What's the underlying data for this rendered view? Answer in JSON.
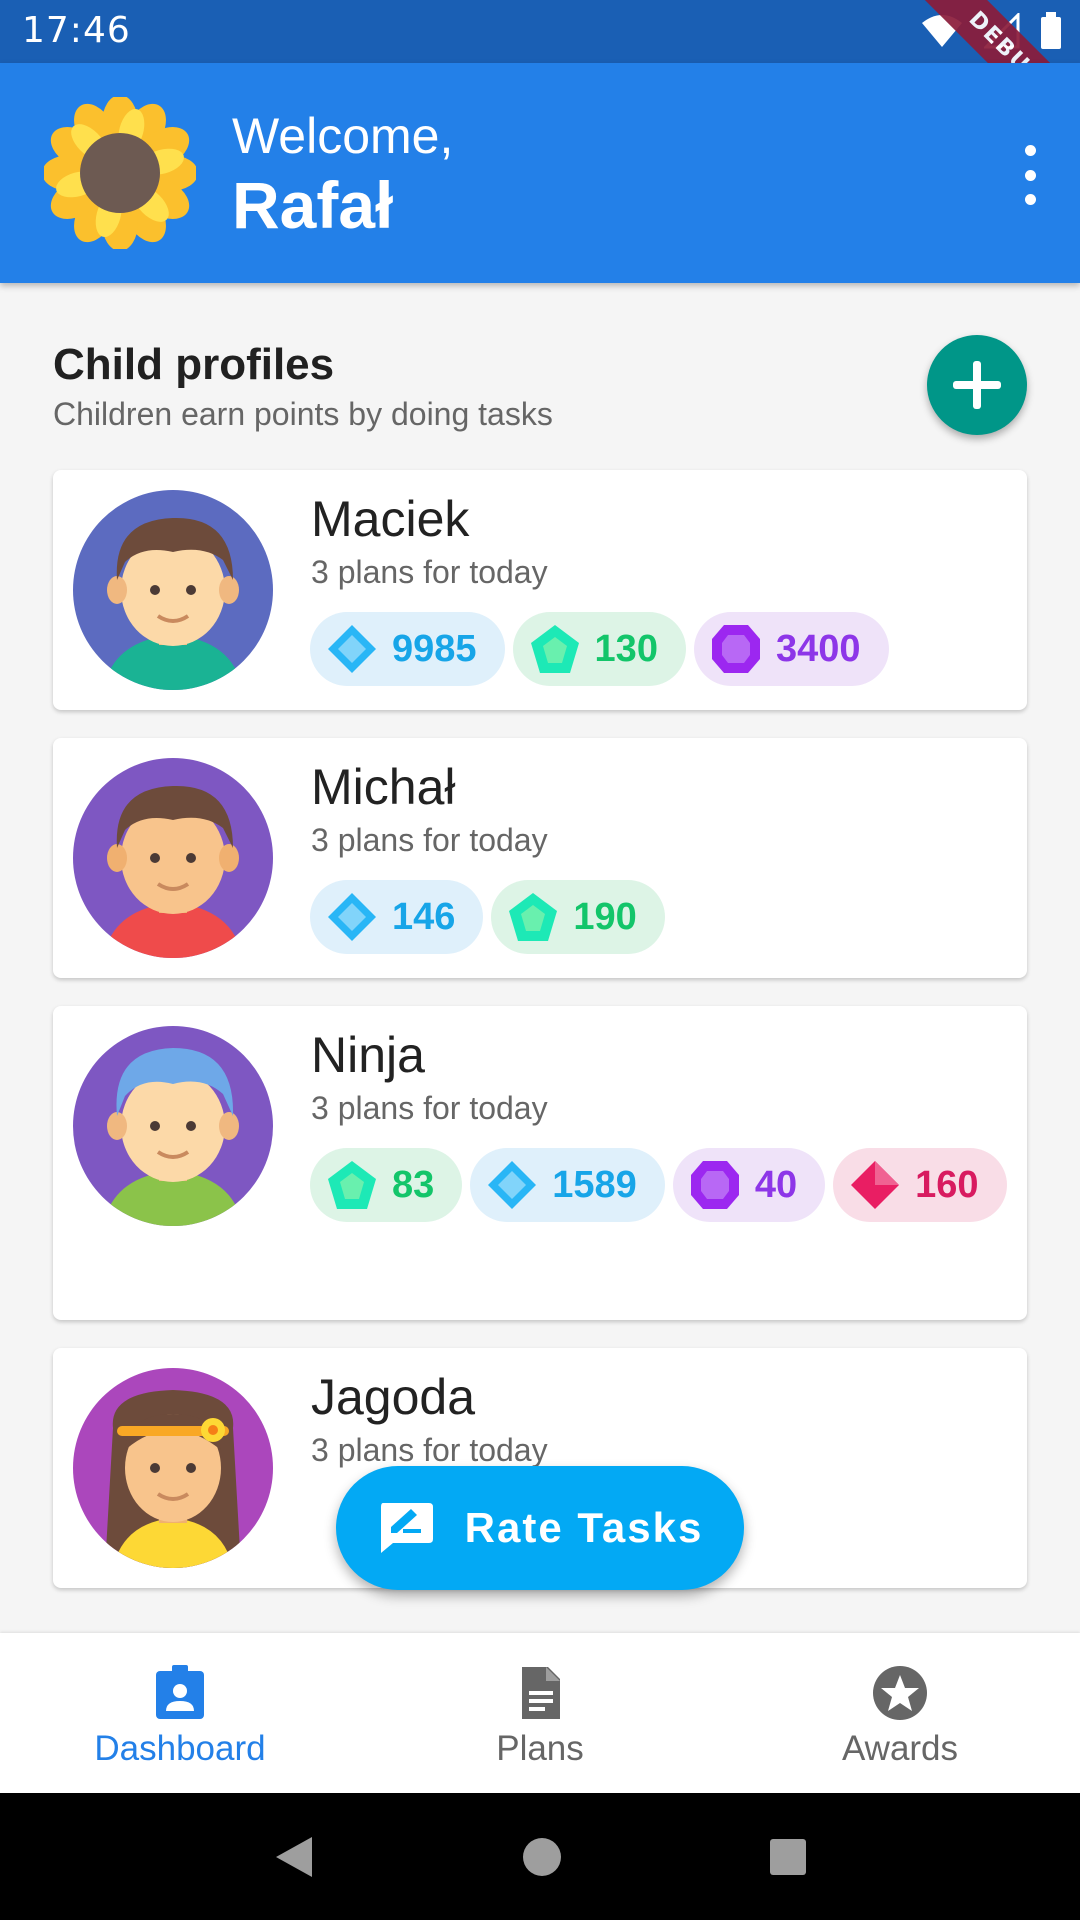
{
  "status_bar": {
    "time": "17:46",
    "debug_label": "DEBUG"
  },
  "app_bar": {
    "welcome": "Welcome,",
    "user_name": "Rafał"
  },
  "section": {
    "title": "Child profiles",
    "subtitle": "Children earn points by doing tasks"
  },
  "children": [
    {
      "name": "Maciek",
      "plans": "3 plans for today",
      "badges": [
        {
          "type": "diamond",
          "value": "9985"
        },
        {
          "type": "emerald",
          "value": "130"
        },
        {
          "type": "amethyst",
          "value": "3400"
        }
      ]
    },
    {
      "name": "Michał",
      "plans": "3 plans for today",
      "badges": [
        {
          "type": "diamond",
          "value": "146"
        },
        {
          "type": "emerald",
          "value": "190"
        }
      ]
    },
    {
      "name": "Ninja",
      "plans": "3 plans for today",
      "badges": [
        {
          "type": "emerald",
          "value": "83"
        },
        {
          "type": "diamond",
          "value": "1589"
        },
        {
          "type": "amethyst",
          "value": "40"
        },
        {
          "type": "ruby",
          "value": "160"
        }
      ]
    },
    {
      "name": "Jagoda",
      "plans": "3 plans for today",
      "badges": []
    }
  ],
  "rate_button": {
    "label": "Rate Tasks"
  },
  "bottom_nav": [
    {
      "label": "Dashboard",
      "icon": "badge-icon",
      "active": true
    },
    {
      "label": "Plans",
      "icon": "document-icon",
      "active": false
    },
    {
      "label": "Awards",
      "icon": "star-icon",
      "active": false
    }
  ],
  "colors": {
    "app_bar": "#2380e8",
    "accent": "#009688",
    "rate_button": "#03a9f4"
  }
}
